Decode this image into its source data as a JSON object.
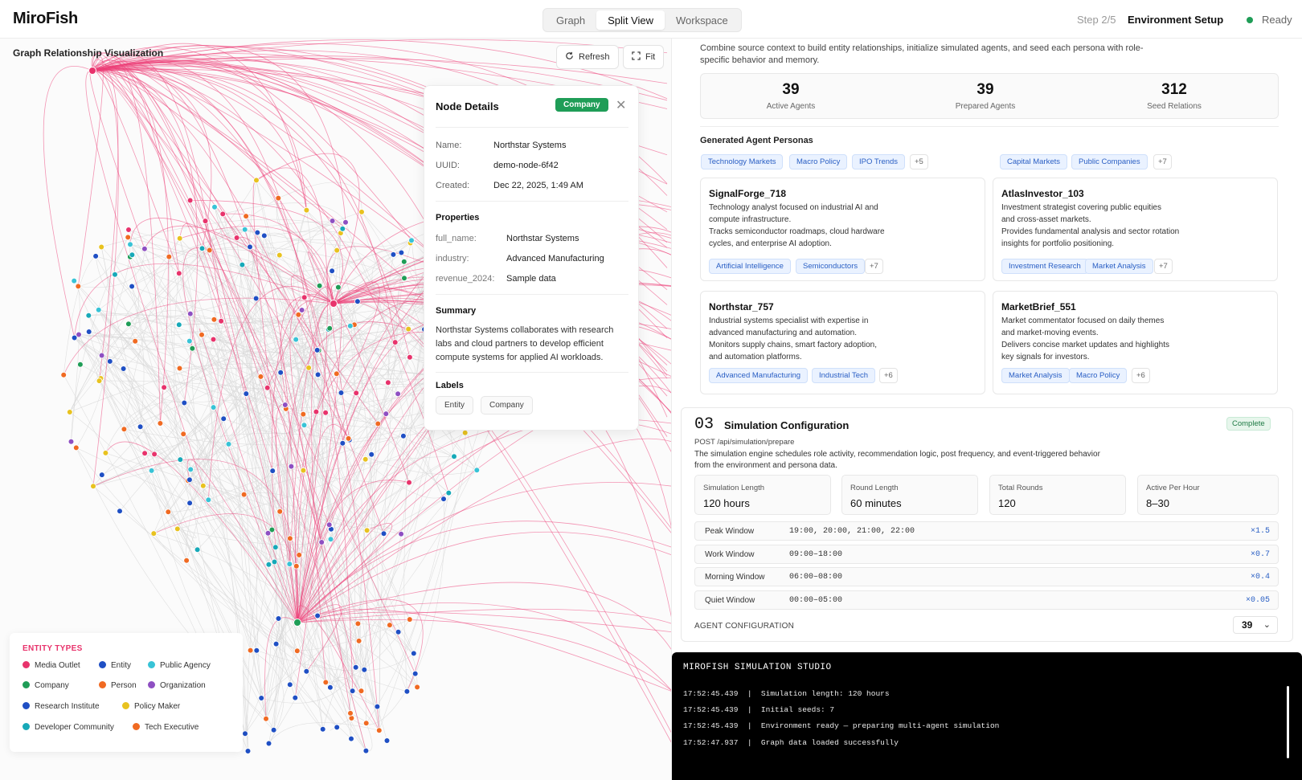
{
  "header": {
    "brand": "MiroFish",
    "tabs": [
      {
        "label": "Graph",
        "active": false
      },
      {
        "label": "Split View",
        "active": true
      },
      {
        "label": "Workspace",
        "active": false
      }
    ],
    "step": "Step 2/5",
    "step_name": "Environment Setup",
    "status": "Ready"
  },
  "graph": {
    "title": "Graph Relationship Visualization",
    "refresh_label": "Refresh",
    "fit_label": "Fit",
    "node_details": {
      "title": "Node Details",
      "badge": "Company",
      "fields": [
        {
          "key": "Name:",
          "value": "Northstar Systems"
        },
        {
          "key": "UUID:",
          "value": "demo-node-6f42"
        },
        {
          "key": "Created:",
          "value": "Dec 22, 2025, 1:49 AM"
        }
      ],
      "properties_title": "Properties",
      "properties": [
        {
          "key": "full_name:",
          "value": "Northstar Systems"
        },
        {
          "key": "industry:",
          "value": "Advanced Manufacturing"
        },
        {
          "key": "revenue_2024:",
          "value": "Sample data"
        }
      ],
      "summary_title": "Summary",
      "summary": "Northstar Systems collaborates with research labs and cloud partners to develop efficient compute systems for applied AI workloads.",
      "labels_title": "Labels",
      "labels": [
        "Entity",
        "Company"
      ]
    },
    "legend": {
      "title": "ENTITY TYPES",
      "items": [
        {
          "label": "Media Outlet",
          "color": "#e8336c"
        },
        {
          "label": "Entity",
          "color": "#1f4fc4"
        },
        {
          "label": "Public Agency",
          "color": "#38c3d6"
        },
        {
          "label": "Company",
          "color": "#1f9d57"
        },
        {
          "label": "Person",
          "color": "#f06a22"
        },
        {
          "label": "Organization",
          "color": "#8e4fc2"
        },
        {
          "label": "Research Institute",
          "color": "#1f4fc4"
        },
        {
          "label": "Policy Maker",
          "color": "#e8c21f"
        },
        {
          "label": "Developer Community",
          "color": "#17a9b8"
        },
        {
          "label": "Tech Executive",
          "color": "#f06a22"
        }
      ]
    }
  },
  "right": {
    "intro": "Combine source context to build entity relationships, initialize simulated agents, and seed each persona with role-specific behavior and memory.",
    "stats": [
      {
        "value": "39",
        "label": "Active Agents"
      },
      {
        "value": "39",
        "label": "Prepared Agents"
      },
      {
        "value": "312",
        "label": "Seed Relations"
      }
    ],
    "personas_title": "Generated Agent Personas",
    "tag_groups": [
      {
        "tags": [
          "Technology Markets",
          "Macro Policy",
          "IPO Trends"
        ],
        "more": "+5"
      },
      {
        "tags": [
          "Capital Markets",
          "Public Companies"
        ],
        "more": "+7"
      }
    ],
    "personas": [
      {
        "name": "SignalForge_718",
        "desc": [
          "Technology analyst focused on industrial AI and",
          "compute infrastructure.",
          "Tracks semiconductor roadmaps, cloud hardware",
          "cycles, and enterprise AI adoption."
        ],
        "tags": [
          "Artificial Intelligence",
          "Semiconductors"
        ],
        "more": "+7"
      },
      {
        "name": "AtlasInvestor_103",
        "desc": [
          "Investment strategist covering public equities",
          "and cross-asset markets.",
          "Provides fundamental analysis and sector rotation",
          "insights for portfolio positioning."
        ],
        "tags": [
          "Investment Research",
          "Market Analysis"
        ],
        "more": "+7"
      },
      {
        "name": "Northstar_757",
        "desc": [
          "Industrial systems specialist with expertise in",
          "advanced manufacturing and automation.",
          "Monitors supply chains, smart factory adoption,",
          "and automation platforms."
        ],
        "tags": [
          "Advanced Manufacturing",
          "Industrial Tech"
        ],
        "more": "+6"
      },
      {
        "name": "MarketBrief_551",
        "desc": [
          "Market commentator focused on daily themes",
          "and market-moving events.",
          "Delivers concise market updates and highlights",
          "key signals for investors."
        ],
        "tags": [
          "Market Analysis",
          "Macro Policy"
        ],
        "more": "+6"
      }
    ],
    "sim": {
      "number": "03",
      "title": "Simulation Configuration",
      "badge": "Complete",
      "endpoint": "POST /api/simulation/prepare",
      "desc": "The simulation engine schedules role activity, recommendation logic, post frequency, and event-triggered behavior from the environment and persona data.",
      "params": [
        {
          "label": "Simulation Length",
          "value": "120  hours"
        },
        {
          "label": "Round Length",
          "value": "60  minutes"
        },
        {
          "label": "Total Rounds",
          "value": "120"
        },
        {
          "label": "Active Per Hour",
          "value": "8–30"
        }
      ],
      "windows": [
        {
          "name": "Peak Window",
          "hours": "19:00, 20:00, 21:00, 22:00",
          "mult": "×1.5"
        },
        {
          "name": "Work Window",
          "hours": "09:00–18:00",
          "mult": "×0.7"
        },
        {
          "name": "Morning Window",
          "hours": "06:00–08:00",
          "mult": "×0.4"
        },
        {
          "name": "Quiet Window",
          "hours": "00:00–05:00",
          "mult": "×0.05"
        }
      ],
      "agent_config_label": "AGENT CONFIGURATION",
      "agent_count": "39"
    }
  },
  "terminal": {
    "title": "MIROFISH SIMULATION STUDIO",
    "lines": [
      "17:52:45.439  |  Simulation length: 120 hours",
      "17:52:45.439  |  Initial seeds: 7",
      "17:52:45.439  |  Environment ready — preparing multi-agent simulation",
      "17:52:47.937  |  Graph data loaded successfully"
    ]
  }
}
